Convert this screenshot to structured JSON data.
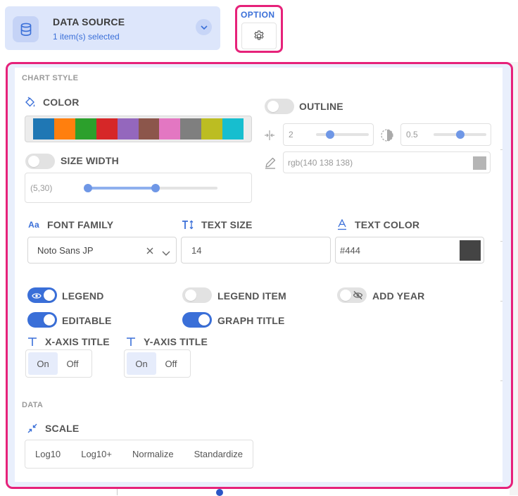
{
  "data_source": {
    "title": "DATA SOURCE",
    "subtitle": "1 item(s) selected",
    "icon": "database-icon"
  },
  "option": {
    "label": "OPTION",
    "icon": "gear-icon"
  },
  "chart_style": {
    "section_label": "CHART STYLE",
    "color_label": "COLOR",
    "palette": [
      "#1f77b4",
      "#ff7f0e",
      "#2ca02c",
      "#d62728",
      "#9467bd",
      "#8c564b",
      "#e377c2",
      "#7f7f7f",
      "#bcbd22",
      "#17becf"
    ],
    "outline": {
      "label": "OUTLINE",
      "enabled": false
    },
    "outline_width": {
      "value": "2",
      "slider_fraction": 0.27
    },
    "outline_opacity": {
      "value": "0.5",
      "slider_fraction": 0.5
    },
    "outline_color": {
      "value": "rgb(140 138 138)",
      "swatch": "#b5b5b5"
    },
    "size_width": {
      "label": "SIZE WIDTH",
      "enabled": false,
      "range_text": "(5,30)",
      "range_low_fraction": 0.0,
      "range_high_fraction": 0.52
    },
    "font_family": {
      "label": "FONT FAMILY",
      "value": "Noto Sans JP"
    },
    "text_size": {
      "label": "TEXT SIZE",
      "value": "14"
    },
    "text_color": {
      "label": "TEXT COLOR",
      "value": "#444",
      "swatch": "#444444"
    },
    "toggles": {
      "legend": {
        "label": "LEGEND",
        "on": true
      },
      "legend_item": {
        "label": "LEGEND ITEM",
        "on": false
      },
      "add_year": {
        "label": "ADD YEAR",
        "on": false
      },
      "editable": {
        "label": "EDITABLE",
        "on": true
      },
      "graph_title": {
        "label": "GRAPH TITLE",
        "on": true
      }
    },
    "x_axis_title": {
      "label": "X-AXIS TITLE",
      "on": "On",
      "off": "Off",
      "selected": "On"
    },
    "y_axis_title": {
      "label": "Y-AXIS TITLE",
      "on": "On",
      "off": "Off",
      "selected": "On"
    }
  },
  "data_section": {
    "section_label": "DATA",
    "scale_label": "SCALE",
    "scale_options": [
      "Log10",
      "Log10+",
      "Normalize",
      "Standardize"
    ]
  },
  "colors": {
    "accent": "#3a6fd8",
    "highlight_border": "#e6227a",
    "panel_bg": "#e9effc"
  }
}
